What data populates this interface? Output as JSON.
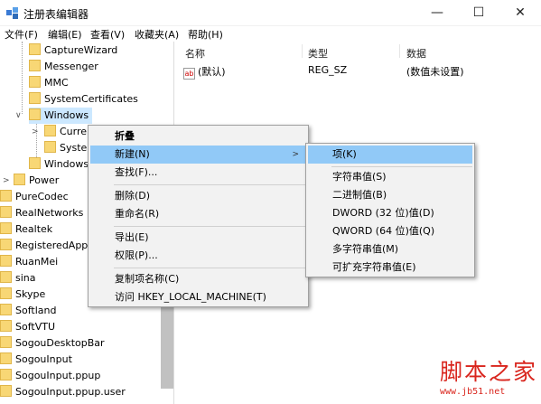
{
  "window": {
    "title": "注册表编辑器",
    "minimize_glyph": "—",
    "maximize_glyph": "☐",
    "close_glyph": "✕"
  },
  "menubar": [
    "文件(F)",
    "编辑(E)",
    "查看(V)",
    "收藏夹(A)",
    "帮助(H)"
  ],
  "tree": {
    "items": [
      {
        "label": "CaptureWizard"
      },
      {
        "label": "Messenger"
      },
      {
        "label": "MMC"
      },
      {
        "label": "SystemCertificates"
      },
      {
        "label": "Windows"
      },
      {
        "label": "Curre"
      },
      {
        "label": "Syster"
      },
      {
        "label": "Windows"
      },
      {
        "label": "Power"
      },
      {
        "label": "PureCodec"
      },
      {
        "label": "RealNetworks"
      },
      {
        "label": "Realtek"
      },
      {
        "label": "RegisteredAppl"
      },
      {
        "label": "RuanMei"
      },
      {
        "label": "sina"
      },
      {
        "label": "Skype"
      },
      {
        "label": "Softland"
      },
      {
        "label": "SoftVTU"
      },
      {
        "label": "SogouDesktopBar"
      },
      {
        "label": "SogouInput"
      },
      {
        "label": "SogouInput.ppup"
      },
      {
        "label": "SogouInput.ppup.user"
      }
    ]
  },
  "right_pane": {
    "columns": [
      "名称",
      "类型",
      "数据"
    ],
    "rows": [
      {
        "icon": "ab",
        "name": "(默认)",
        "type": "REG_SZ",
        "data": "(数值未设置)"
      }
    ]
  },
  "context_menu": {
    "items": [
      "折叠",
      "新建(N)",
      "查找(F)...",
      "删除(D)",
      "重命名(R)",
      "导出(E)",
      "权限(P)...",
      "复制项名称(C)",
      "访问 HKEY_LOCAL_MACHINE(T)"
    ],
    "highlighted": "新建(N)"
  },
  "submenu": {
    "items": [
      "项(K)",
      "字符串值(S)",
      "二进制值(B)",
      "DWORD (32 位)值(D)",
      "QWORD (64 位)值(Q)",
      "多字符串值(M)",
      "可扩充字符串值(E)"
    ],
    "highlighted": "项(K)"
  },
  "watermark": {
    "main": "脚本之家",
    "url": "www.jb51.net"
  },
  "colors": {
    "highlight": "#91c9f7",
    "selection": "#cce8ff",
    "folder": "#f8d775",
    "watermark": "#d9251d"
  }
}
